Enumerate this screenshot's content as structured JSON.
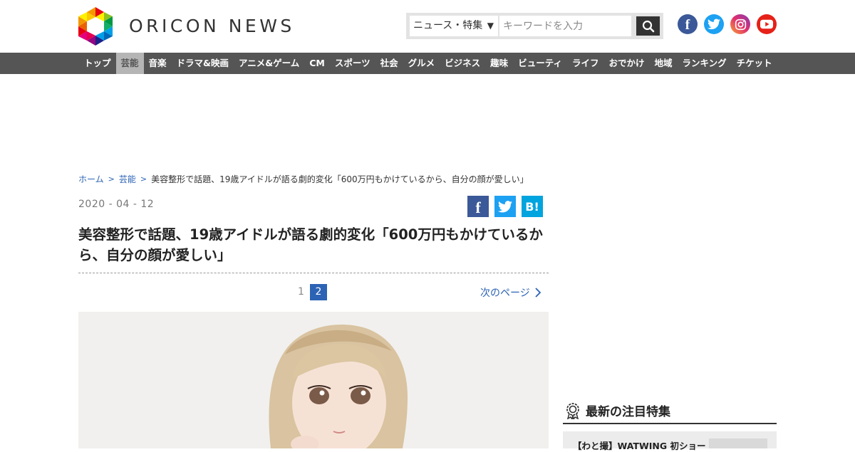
{
  "header": {
    "logo_text": "ORICON NEWS",
    "search": {
      "category": "ニュース・特集",
      "placeholder": "キーワードを入力"
    },
    "social": [
      "facebook-icon",
      "twitter-icon",
      "instagram-icon",
      "youtube-icon"
    ],
    "colors": {
      "facebook": "#3b5998",
      "twitter": "#1da1f2",
      "youtube": "#e62117",
      "nav_bg": "#555555",
      "link": "#2c63b5"
    }
  },
  "nav": {
    "items": [
      "トップ",
      "芸能",
      "音楽",
      "ドラマ&映画",
      "アニメ&ゲーム",
      "CM",
      "スポーツ",
      "社会",
      "グルメ",
      "ビジネス",
      "趣味",
      "ビューティ",
      "ライフ",
      "おでかけ",
      "地域",
      "ランキング",
      "チケット"
    ],
    "active_index": 1
  },
  "breadcrumb": {
    "home": "ホーム",
    "category": "芸能",
    "current": "美容整形で話題、19歳アイドルが語る劇的変化「600万円もかけているから、自分の顔が愛しい」"
  },
  "article": {
    "date": "2020 - 04 - 12",
    "share": {
      "facebook": "f",
      "hatena": "B!"
    },
    "title": "美容整形で話題、19歳アイドルが語る劇的変化「600万円もかけているから、自分の顔が愛しい」",
    "pagination": {
      "page1": "1",
      "page2": "2",
      "current": 2,
      "next_label": "次のページ"
    }
  },
  "sidebar": {
    "feature_title": "最新の注目特集",
    "first_item": "【わと撮】WATWING 初ショー"
  }
}
